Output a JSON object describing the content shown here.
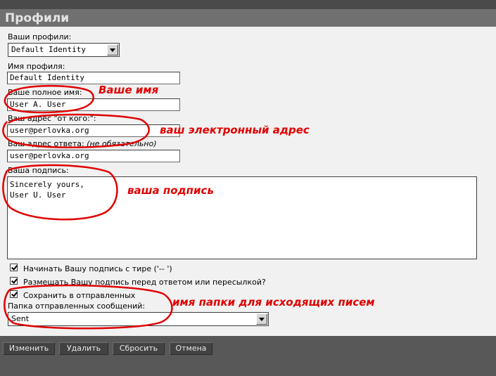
{
  "title": "Профили",
  "form": {
    "profiles_label": "Ваши профили:",
    "profiles_selected": "Default Identity",
    "profile_name_label": "Имя профиля:",
    "profile_name_value": "Default Identity",
    "full_name_label": "Ваше полное имя:",
    "full_name_value": "User A. User",
    "from_label": "Ваш адрес \"от кого:\":",
    "from_value": "user@perlovka.org",
    "reply_label": "Ваш адрес ответа:",
    "reply_optional": "(не обязательно)",
    "reply_value": "user@perlovka.org",
    "signature_label": "Ваша подпись:",
    "signature_value": "Sincerely yours,\nUser U. User",
    "dash_label": "Начинать Вашу подпись с тире ('-- ')",
    "dash_checked": true,
    "before_reply_label": "Размещать Вашу подпись перед ответом или пересылкой?",
    "before_reply_checked": true,
    "save_sent_label": "Сохранить в отправленных",
    "save_sent_checked": true,
    "sent_folder_label": "Папка отправленных сообщений:",
    "sent_folder_value": "Sent"
  },
  "annotations": {
    "name": "Ваше имя",
    "email": "ваш электронный адрес",
    "signature": "ваша подпись",
    "folder": "имя папки для исходящих писем",
    "color": "#e00000"
  },
  "buttons": {
    "change": "Изменить",
    "delete": "Удалить",
    "reset": "Сбросить",
    "cancel": "Отмена"
  }
}
